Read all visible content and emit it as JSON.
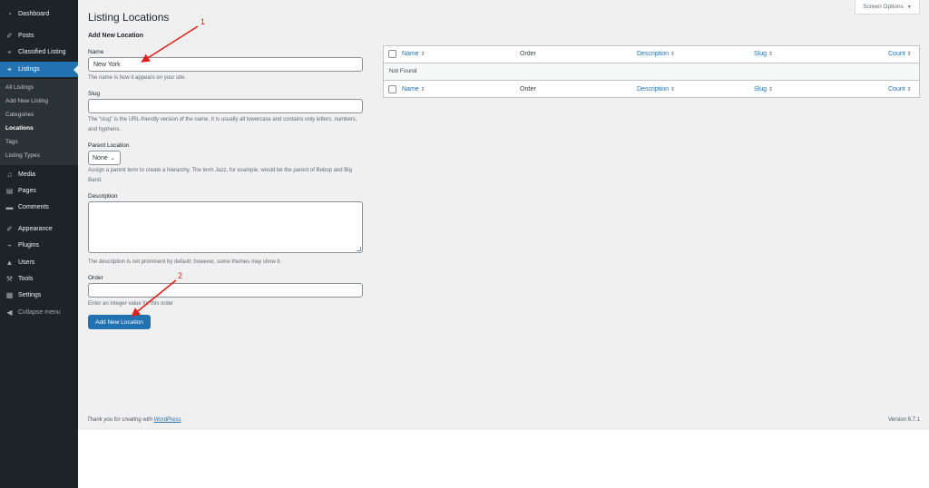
{
  "sidebar": {
    "items": [
      {
        "label": "Dashboard",
        "icon": "dashboard-icon",
        "glyph": "◔"
      },
      {
        "label": "Posts",
        "icon": "pin-icon",
        "glyph": "✐"
      },
      {
        "label": "Classified Listing",
        "icon": "location-pin-icon",
        "glyph": "⌖"
      },
      {
        "label": "Listings",
        "icon": "location-pin-icon",
        "glyph": "⌖"
      },
      {
        "label": "Media",
        "icon": "media-icon",
        "glyph": "♫"
      },
      {
        "label": "Pages",
        "icon": "pages-icon",
        "glyph": "▤"
      },
      {
        "label": "Comments",
        "icon": "comment-icon",
        "glyph": "▬"
      },
      {
        "label": "Appearance",
        "icon": "brush-icon",
        "glyph": "✐"
      },
      {
        "label": "Plugins",
        "icon": "plugin-icon",
        "glyph": "⌁"
      },
      {
        "label": "Users",
        "icon": "user-icon",
        "glyph": "▲"
      },
      {
        "label": "Tools",
        "icon": "wrench-icon",
        "glyph": "⚒"
      },
      {
        "label": "Settings",
        "icon": "settings-icon",
        "glyph": "▦"
      },
      {
        "label": "Collapse menu",
        "icon": "collapse-icon",
        "glyph": "◀"
      }
    ],
    "submenu": [
      "All Listings",
      "Add New Listing",
      "Categories",
      "Locations",
      "Tags",
      "Listing Types"
    ]
  },
  "header": {
    "screen_options": "Screen Options",
    "title": "Listing Locations"
  },
  "form": {
    "heading": "Add New Location",
    "name_label": "Name",
    "name_value": "New York",
    "name_help": "The name is how it appears on your site.",
    "slug_label": "Slug",
    "slug_value": "",
    "slug_help": "The “slug” is the URL-friendly version of the name. It is usually all lowercase and contains only letters, numbers, and hyphens.",
    "parent_label": "Parent Location",
    "parent_value": "None",
    "parent_help": "Assign a parent term to create a hierarchy. The term Jazz, for example, would be the parent of Bebop and Big Band.",
    "description_label": "Description",
    "description_help": "The description is not prominent by default; however, some themes may show it.",
    "order_label": "Order",
    "order_help": "Enter an integer value for this order",
    "submit_label": "Add New Location"
  },
  "table": {
    "columns": [
      "Name",
      "Order",
      "Description",
      "Slug",
      "Count"
    ],
    "empty_text": "Not Found"
  },
  "annotations": {
    "arrow1": "1",
    "arrow2": "2",
    "color": "#e0201b"
  },
  "footer": {
    "thanks_prefix": "Thank you for creating with",
    "thanks_link": "WordPress",
    "thanks_suffix": ".",
    "version": "Version 6.7.1"
  },
  "colors": {
    "accent": "#2271b1",
    "sidebar": "#1d2327",
    "background": "#f0f0f1"
  }
}
